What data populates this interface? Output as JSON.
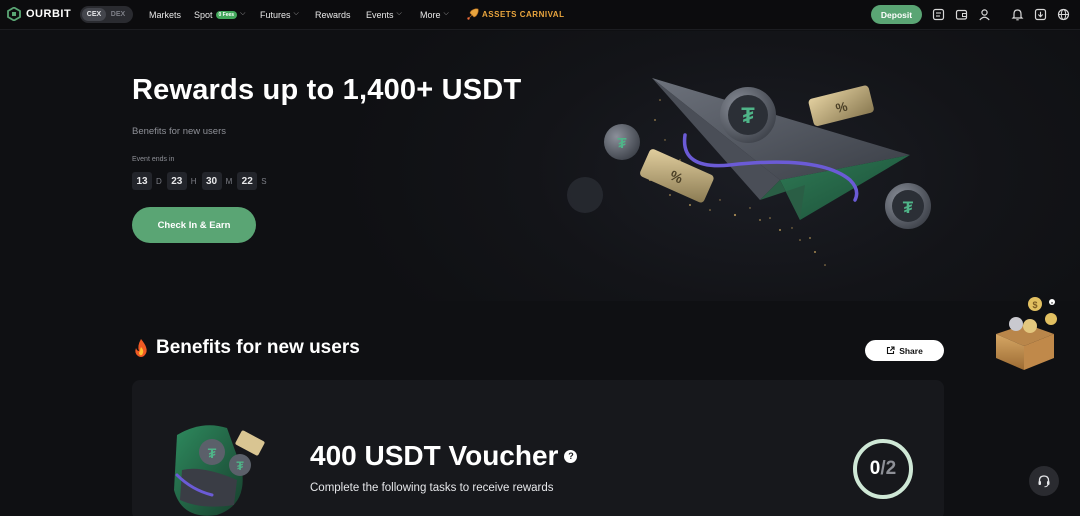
{
  "header": {
    "logo_text": "OURBIT",
    "segments": [
      {
        "label": "CEX",
        "active": true
      },
      {
        "label": "DEX",
        "active": false
      }
    ],
    "menu": {
      "markets": "Markets",
      "spot": "Spot",
      "spot_badge": "0 Fees",
      "futures": "Futures",
      "rewards": "Rewards",
      "events": "Events",
      "more": "More"
    },
    "carnival": "ASSETS CARNIVAL",
    "deposit": "Deposit",
    "icons": [
      "orders-icon",
      "wallet-icon",
      "user-icon",
      "bell-icon",
      "download-icon",
      "globe-icon"
    ]
  },
  "hero": {
    "title": "Rewards up to 1,400+ USDT",
    "subtitle": "Benefits for new users",
    "ends_label": "Event ends in",
    "countdown": {
      "d": "13",
      "d_unit": "D",
      "h": "23",
      "h_unit": "H",
      "m": "30",
      "m_unit": "M",
      "s": "22",
      "s_unit": "S"
    },
    "cta": "Check In & Earn"
  },
  "benefits": {
    "title": "Benefits for new users",
    "share": "Share",
    "voucher_title": "400 USDT Voucher",
    "voucher_sub": "Complete the following tasks to receive rewards",
    "progress_done": "0",
    "progress_total": "/2",
    "progress_fraction": 0
  },
  "colors": {
    "accent": "#5aa574",
    "background": "#0f1013",
    "card": "#17181c",
    "carnival": "#e9a53e"
  }
}
